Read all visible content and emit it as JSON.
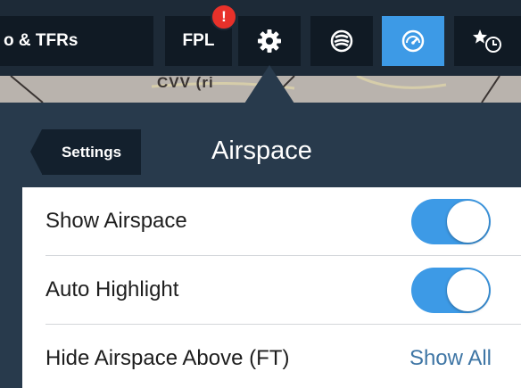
{
  "toolbar": {
    "buttons": [
      {
        "label": "o & TFRs"
      },
      {
        "label": "FPL",
        "badge": "!"
      },
      {
        "icon": "gear-icon"
      },
      {
        "icon": "globe-icon"
      },
      {
        "icon": "gauge-icon",
        "active": true
      },
      {
        "icon": "recent-favorites-icon"
      }
    ],
    "accent_color": "#3d9ae6",
    "badge_color": "#e8312a"
  },
  "map": {
    "label": "CVV (ri"
  },
  "popover": {
    "back_label": "Settings",
    "title": "Airspace",
    "rows": [
      {
        "label": "Show Airspace",
        "type": "toggle",
        "on": true
      },
      {
        "label": "Auto Highlight",
        "type": "toggle",
        "on": true
      },
      {
        "label": "Hide Airspace Above (FT)",
        "type": "value",
        "value": "Show All"
      }
    ]
  }
}
